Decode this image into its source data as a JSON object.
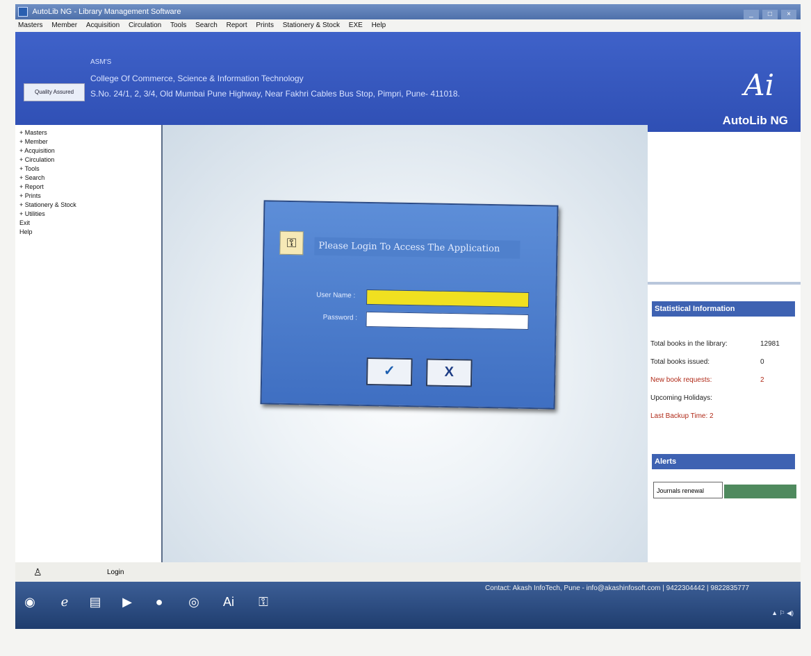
{
  "window": {
    "title": "AutoLib NG - Library Management Software"
  },
  "menu": [
    "Masters",
    "Member",
    "Acquisition",
    "Circulation",
    "Tools",
    "Search",
    "Report",
    "Prints",
    "Stationery & Stock",
    "EXE",
    "Help"
  ],
  "header": {
    "short_name": "ASM'S",
    "institute": "College Of Commerce, Science & Information Technology",
    "address": "S.No. 24/1, 2, 3/4, Old Mumbai Pune Highway, Near Fakhri Cables Bus Stop, Pimpri, Pune- 411018.",
    "inst_box": "Quality Assured",
    "logo_text": "AutoLib NG"
  },
  "sidebar": {
    "items": [
      "+ Masters",
      "+ Member",
      "+ Acquisition",
      "+ Circulation",
      "+ Tools",
      "+ Search",
      "+ Report",
      "+ Prints",
      "+ Stationery & Stock",
      "+ Utilities",
      "Exit",
      "Help"
    ]
  },
  "dialog": {
    "title": "Please Login To Access The Application",
    "user_label": "User Name :",
    "pass_label": "Password :",
    "user_value": "",
    "pass_value": "",
    "ok_glyph": "✓",
    "cancel_glyph": "X"
  },
  "stats": {
    "title": "Statistical Information",
    "total_books_label": "Total books in the library:",
    "total_books": "12981",
    "issued_label": "Total books issued:",
    "issued": "0",
    "requests_label": "New book requests:",
    "requests": "2",
    "holidays_label": "Upcoming Holidays:",
    "backup_label": "Last Backup Time: 2"
  },
  "alerts": {
    "title": "Alerts",
    "tab": "Journals renewal"
  },
  "statusbar": {
    "label": "Login"
  },
  "taskbar": {
    "contact": "Contact: Akash InfoTech, Pune - info@akashinfosoft.com | 9422304442 | 9822835777"
  },
  "colors": {
    "header_blue": "#3f62c9",
    "field_yellow": "#f0e020",
    "alerts_green": "#4f8a5e",
    "warning_red": "#b02a18"
  }
}
